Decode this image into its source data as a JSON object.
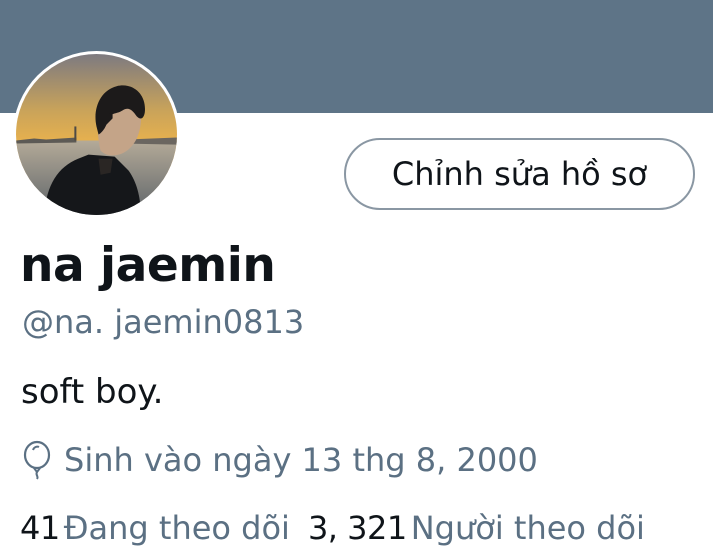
{
  "profile": {
    "display_name": "na jaemin",
    "handle": "@na. jaemin0813",
    "bio": "soft boy.",
    "birth": "Sinh vào ngày 13 thg 8,  2000",
    "edit_button_label": "Chỉnh sửa hồ sơ",
    "following_count": "41",
    "following_label": "Đang theo dõi",
    "followers_count": "3, 321",
    "followers_label": "Người theo dõi"
  },
  "icons": {
    "birthday": "balloon-icon"
  },
  "colors": {
    "banner": "#5e7487",
    "primary_text": "#0f1419",
    "secondary_text": "#5b7083",
    "button_border": "#8a97a3"
  }
}
